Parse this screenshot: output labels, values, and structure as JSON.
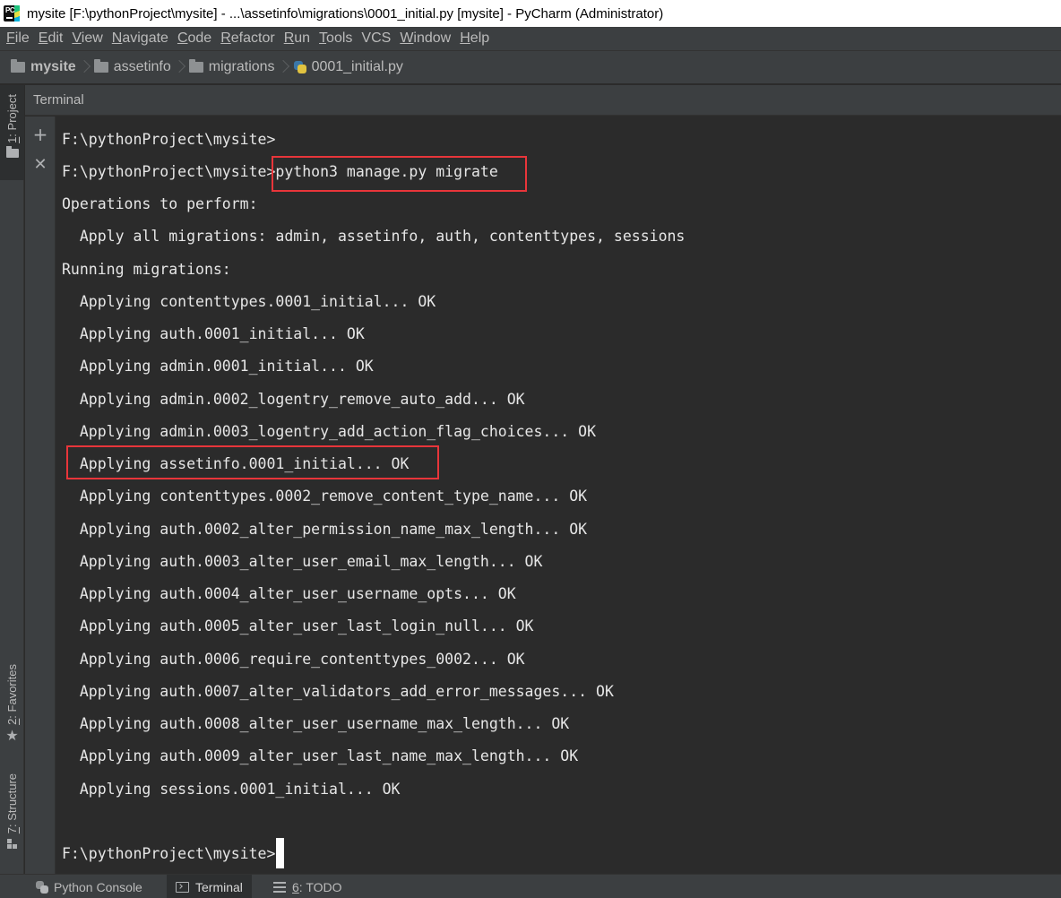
{
  "titlebar": {
    "title": "mysite [F:\\pythonProject\\mysite] - ...\\assetinfo\\migrations\\0001_initial.py [mysite] - PyCharm (Administrator)"
  },
  "menu": [
    {
      "mnemonic": "F",
      "rest": "ile"
    },
    {
      "mnemonic": "E",
      "rest": "dit"
    },
    {
      "mnemonic": "V",
      "rest": "iew"
    },
    {
      "mnemonic": "N",
      "rest": "avigate"
    },
    {
      "mnemonic": "C",
      "rest": "ode"
    },
    {
      "mnemonic": "R",
      "rest": "efactor"
    },
    {
      "mnemonic": "R",
      "rest": "un"
    },
    {
      "mnemonic": "T",
      "rest": "ools"
    },
    {
      "mnemonic": "",
      "rest": "VCS"
    },
    {
      "mnemonic": "W",
      "rest": "indow"
    },
    {
      "mnemonic": "H",
      "rest": "elp"
    }
  ],
  "breadcrumb": [
    "mysite",
    "assetinfo",
    "migrations",
    "0001_initial.py"
  ],
  "left_tabs": {
    "project": {
      "mnemonic": "1",
      "rest": ": Project"
    },
    "favorites": {
      "mnemonic": "2",
      "rest": ": Favorites"
    },
    "structure": {
      "mnemonic": "7",
      "rest": ": Structure"
    }
  },
  "tool_window": {
    "title": "Terminal",
    "add_icon": "plus-icon",
    "close_icon": "close-icon"
  },
  "terminal": {
    "prompt": "F:\\pythonProject\\mysite>",
    "command": "python3 manage.py migrate",
    "lines": [
      "Operations to perform:",
      "  Apply all migrations: admin, assetinfo, auth, contenttypes, sessions",
      "Running migrations:",
      "  Applying contenttypes.0001_initial... OK",
      "  Applying auth.0001_initial... OK",
      "  Applying admin.0001_initial... OK",
      "  Applying admin.0002_logentry_remove_auto_add... OK",
      "  Applying admin.0003_logentry_add_action_flag_choices... OK",
      "  Applying assetinfo.0001_initial... OK",
      "  Applying contenttypes.0002_remove_content_type_name... OK",
      "  Applying auth.0002_alter_permission_name_max_length... OK",
      "  Applying auth.0003_alter_user_email_max_length... OK",
      "  Applying auth.0004_alter_user_username_opts... OK",
      "  Applying auth.0005_alter_user_last_login_null... OK",
      "  Applying auth.0006_require_contenttypes_0002... OK",
      "  Applying auth.0007_alter_validators_add_error_messages... OK",
      "  Applying auth.0008_alter_user_username_max_length... OK",
      "  Applying auth.0009_alter_user_last_name_max_length... OK",
      "  Applying sessions.0001_initial... OK"
    ]
  },
  "bottom_tabs": {
    "python_console": {
      "mnemonic": "",
      "rest": "Python Console"
    },
    "terminal": {
      "mnemonic": "",
      "rest": "Terminal"
    },
    "todo": {
      "mnemonic": "6",
      "rest": ": TODO"
    }
  },
  "colors": {
    "highlight": "#e8353a",
    "background": "#2b2b2b",
    "terminal_text": "#e6e6e6"
  }
}
